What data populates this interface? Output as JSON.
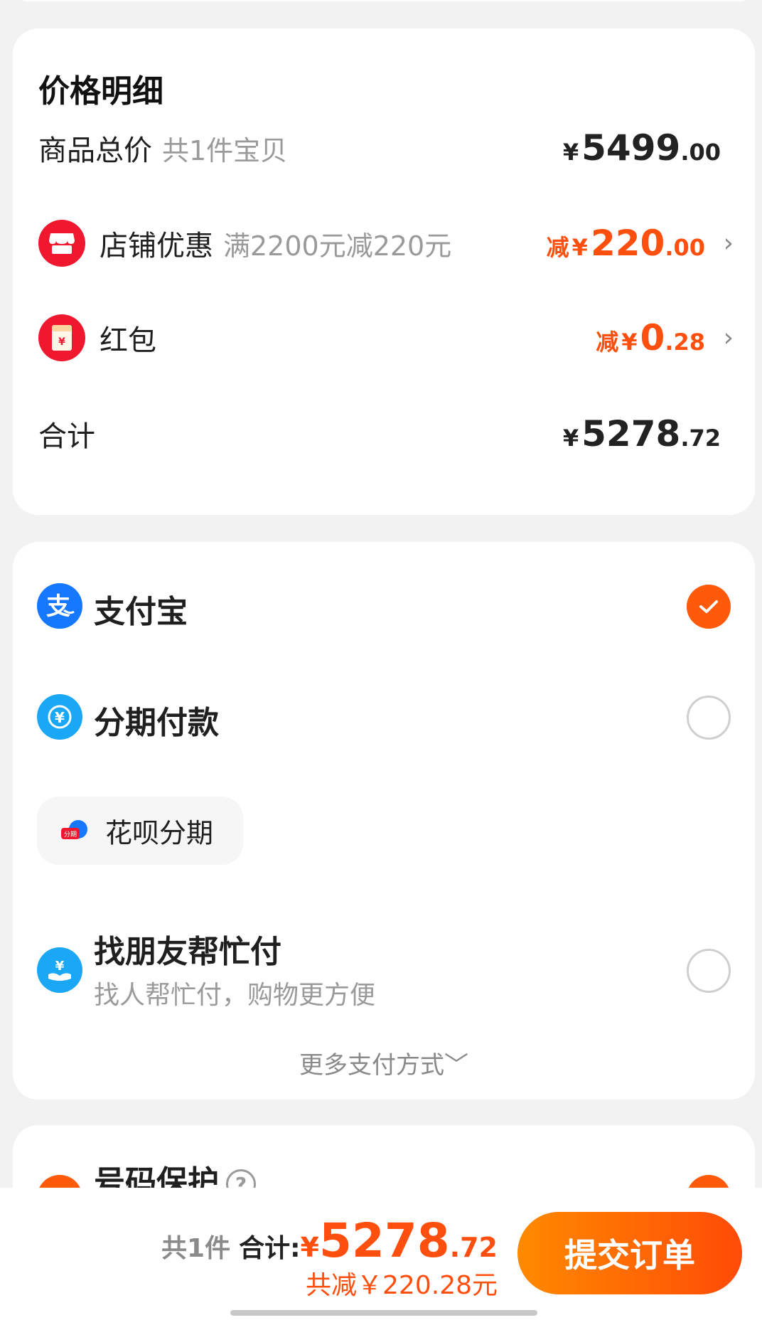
{
  "price_detail": {
    "title": "价格明细",
    "goods_total": {
      "label": "商品总价",
      "sub": "共1件宝贝",
      "yen": "¥",
      "int": "5499",
      "dec": ".00"
    },
    "shop_discount": {
      "label": "店铺优惠",
      "sub": "满2200元减220元",
      "minus": "减",
      "yen": "¥",
      "int": "220",
      "dec": ".00",
      "icon": "shop-icon"
    },
    "red_packet": {
      "label": "红包",
      "minus": "减",
      "yen": "¥",
      "int": "0",
      "dec": ".28",
      "icon": "red-packet-icon"
    },
    "total": {
      "label": "合计",
      "yen": "¥",
      "int": "5278",
      "dec": ".72"
    }
  },
  "payment": {
    "options": [
      {
        "label": "支付宝",
        "selected": true,
        "icon": "alipay-icon"
      },
      {
        "label": "分期付款",
        "selected": false,
        "icon": "installment-icon"
      },
      {
        "label": "找朋友帮忙付",
        "sub": "找人帮忙付，购物更方便",
        "selected": false,
        "icon": "friend-pay-icon"
      }
    ],
    "installment_chip": {
      "label": "花呗分期",
      "icon_text": "分期"
    },
    "more_label": "更多支付方式",
    "more_icon": "chevron-down-icon"
  },
  "phone_protect": {
    "title": "号码保护",
    "help": "?"
  },
  "bottom_bar": {
    "count": "共1件",
    "total_label": "合计:",
    "yen": "¥",
    "int": "5278",
    "dec": ".72",
    "saved": "共减￥220.28元",
    "submit": "提交订单"
  },
  "colors": {
    "accent": "#ff4f0f",
    "alipay": "#1677ff",
    "installment": "#1aa7f5",
    "red": "#f0182e"
  }
}
